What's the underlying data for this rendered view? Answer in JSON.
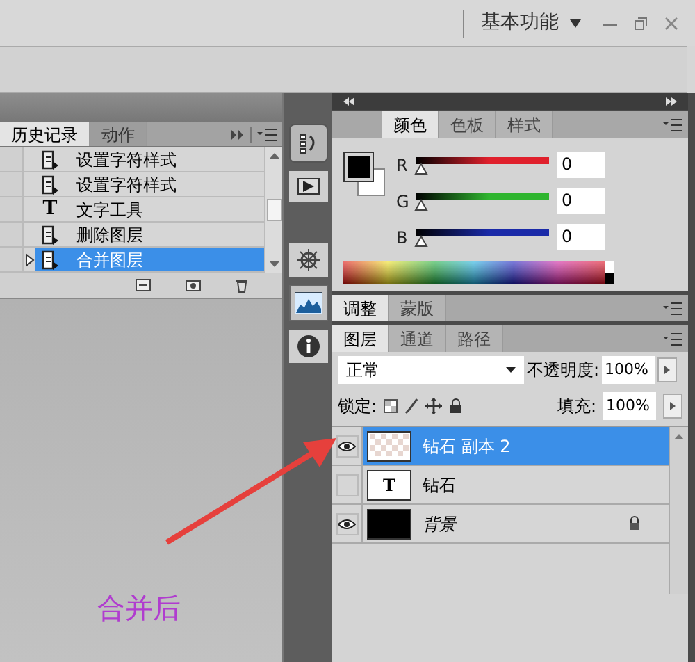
{
  "workspace": {
    "label": "基本功能"
  },
  "history_panel": {
    "tabs": [
      {
        "label": "历史记录",
        "selected": true
      },
      {
        "label": "动作",
        "selected": false
      }
    ],
    "items": [
      {
        "label": "设置字符样式",
        "kind": "doc",
        "selected": false
      },
      {
        "label": "设置字符样式",
        "kind": "doc",
        "selected": false
      },
      {
        "label": "文字工具",
        "kind": "type",
        "glyph": "T",
        "selected": false
      },
      {
        "label": "删除图层",
        "kind": "doc",
        "selected": false
      },
      {
        "label": "合并图层",
        "kind": "doc",
        "selected": true
      }
    ]
  },
  "color_panel": {
    "tabs": [
      {
        "label": "颜色",
        "selected": true
      },
      {
        "label": "色板",
        "selected": false
      },
      {
        "label": "样式",
        "selected": false
      }
    ],
    "channels": [
      {
        "name": "R",
        "value": "0",
        "level": 0,
        "color": "#e0202c"
      },
      {
        "name": "G",
        "value": "0",
        "level": 0,
        "color": "#2fb52f"
      },
      {
        "name": "B",
        "value": "0",
        "level": 0,
        "color": "#1a2aa8"
      }
    ]
  },
  "adjust_tabs": [
    {
      "label": "调整",
      "selected": true
    },
    {
      "label": "蒙版",
      "selected": false
    }
  ],
  "layers_panel": {
    "tabs": [
      {
        "label": "图层",
        "selected": true
      },
      {
        "label": "通道",
        "selected": false
      },
      {
        "label": "路径",
        "selected": false
      }
    ],
    "blend_mode": "正常",
    "opacity_label": "不透明度:",
    "opacity": "100%",
    "lock_label": "锁定:",
    "fill_label": "填充:",
    "fill": "100%",
    "layers": [
      {
        "name": "钻石 副本 2",
        "kind": "transparent",
        "visible": true,
        "selected": true,
        "locked": false,
        "italic": false
      },
      {
        "name": "钻石",
        "kind": "type",
        "glyph": "T",
        "visible": false,
        "selected": false,
        "locked": false,
        "italic": false
      },
      {
        "name": "背景",
        "kind": "fill",
        "visible": true,
        "selected": false,
        "locked": true,
        "italic": true
      }
    ]
  },
  "annotation": {
    "label": "合并后"
  }
}
